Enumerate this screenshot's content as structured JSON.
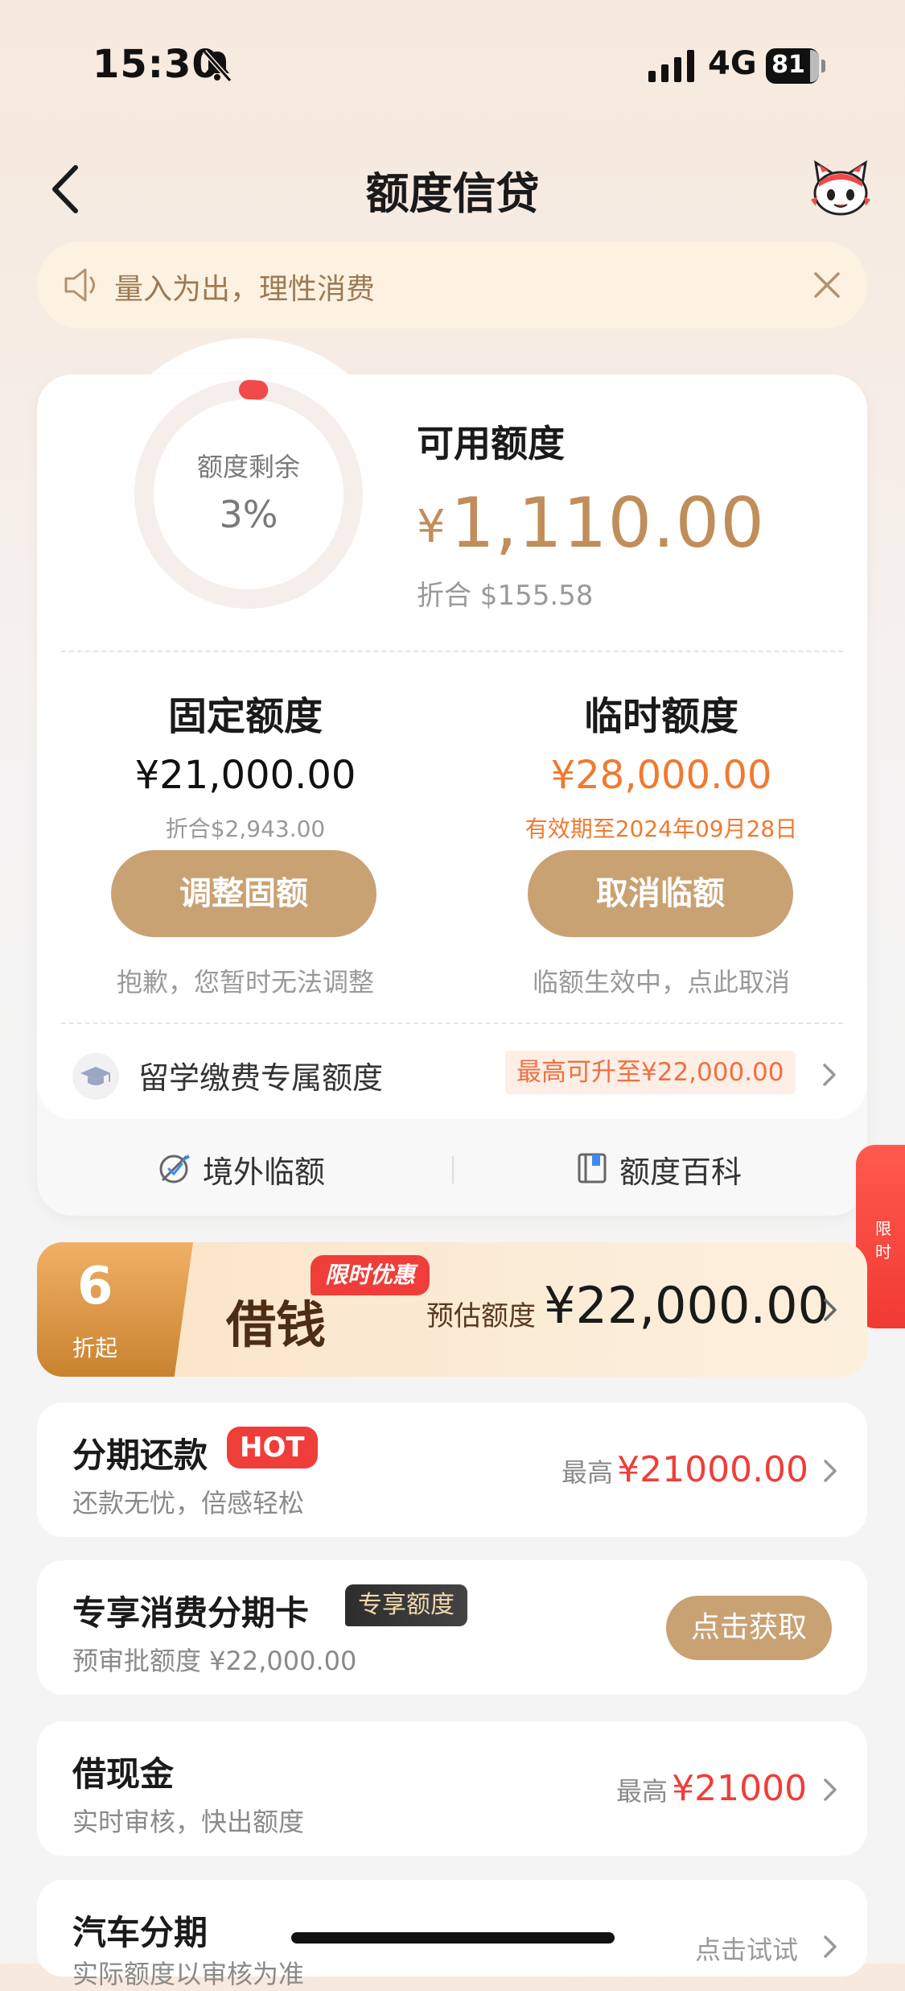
{
  "status_bar": {
    "time": "15:30",
    "network": "4G",
    "battery": "81"
  },
  "nav": {
    "title": "额度信贷"
  },
  "notice": {
    "text": "量入为出，理性消费"
  },
  "summary": {
    "gauge_label": "额度剩余",
    "gauge_value": "3%",
    "gauge_fraction": 0.03,
    "available_label": "可用额度",
    "available_currency": "¥",
    "available_amount": "1,110.00",
    "available_equiv": "折合 $155.58"
  },
  "fixed": {
    "title": "固定额度",
    "amount": "¥21,000.00",
    "equiv": "折合$2,943.00",
    "button": "调整固额",
    "note": "抱歉，您暂时无法调整"
  },
  "temporary": {
    "title": "临时额度",
    "amount": "¥28,000.00",
    "expiry": "有效期至2024年09月28日",
    "button": "取消临额",
    "note": "临额生效中，点此取消"
  },
  "study_abroad": {
    "label": "留学缴费专属额度",
    "tag": "最高可升至¥22,000.00"
  },
  "bottom_tabs": [
    {
      "label": "境外临额"
    },
    {
      "label": "额度百科"
    }
  ],
  "side_float": {
    "text": "限时"
  },
  "loan_banner": {
    "discount_number": "6",
    "discount_suffix": "折起",
    "title": "借钱",
    "hot_tag": "限时优惠",
    "estimate_label": "预估额度",
    "estimate_amount": "¥22,000.00"
  },
  "products": [
    {
      "title": "分期还款",
      "badge": "HOT",
      "subtitle": "还款无忧，倍感轻松",
      "max_label": "最高",
      "max_value": "¥21000.00"
    },
    {
      "title": "专享消费分期卡",
      "badge": "专享额度",
      "subtitle": "预审批额度 ¥22,000.00",
      "button": "点击获取"
    },
    {
      "title": "借现金",
      "subtitle": "实时审核，快出额度",
      "max_label": "最高",
      "max_value": "¥21000"
    },
    {
      "title": "汽车分期",
      "subtitle": "实际额度以审核为准",
      "action": "点击试试"
    }
  ],
  "colors": {
    "accent_gold": "#c9a273",
    "price_gold": "#c08e5a",
    "orange": "#f07a2f",
    "red": "#ef3e3a"
  }
}
